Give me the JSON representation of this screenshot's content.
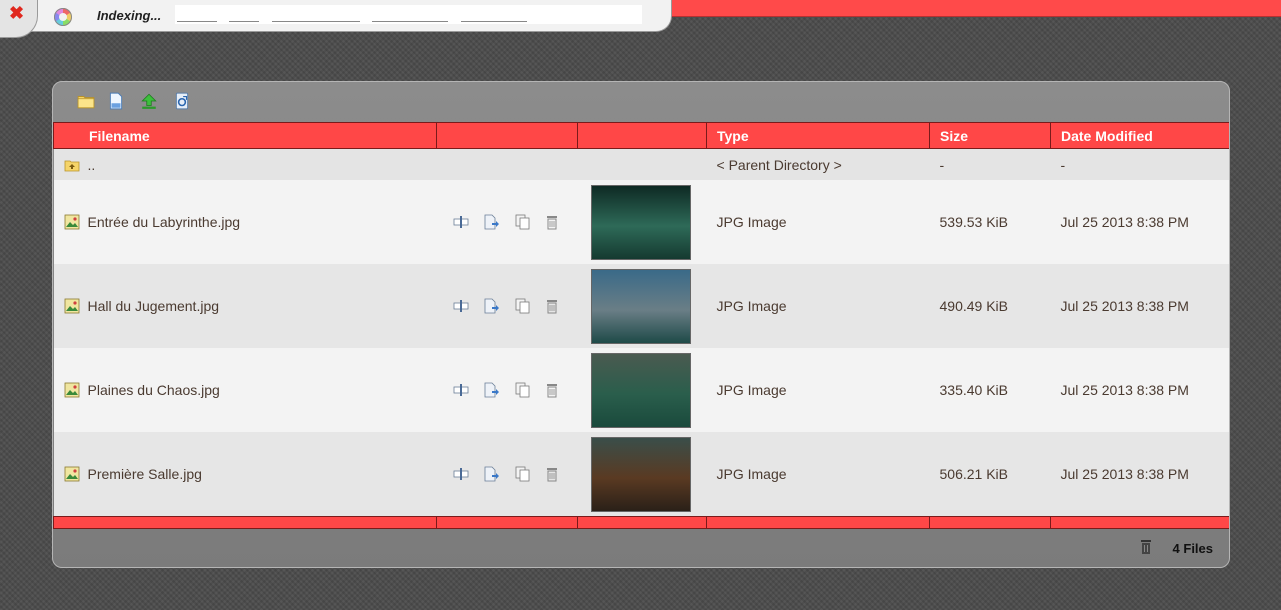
{
  "indexing_label": "Indexing...",
  "toolbar": {
    "buttons": [
      {
        "name": "new-folder-icon"
      },
      {
        "name": "new-file-icon"
      },
      {
        "name": "upload-icon"
      },
      {
        "name": "refresh-icon"
      }
    ]
  },
  "columns": {
    "filename": "Filename",
    "type": "Type",
    "size": "Size",
    "date": "Date Modified"
  },
  "parent": {
    "name": "..",
    "type": "< Parent Directory >",
    "size": "-",
    "date": "-"
  },
  "files": [
    {
      "name": "Entrée du Labyrinthe.jpg",
      "type": "JPG Image",
      "size": "539.53 KiB",
      "date": "Jul 25 2013 8:38 PM",
      "thumb_colors": [
        "#0e2a24",
        "#2e6a58",
        "#153a30"
      ]
    },
    {
      "name": "Hall du Jugement.jpg",
      "type": "JPG Image",
      "size": "490.49 KiB",
      "date": "Jul 25 2013 8:38 PM",
      "thumb_colors": [
        "#3a6a88",
        "#6a7e86",
        "#1e4a48"
      ]
    },
    {
      "name": "Plaines du Chaos.jpg",
      "type": "JPG Image",
      "size": "335.40 KiB",
      "date": "Jul 25 2013 8:38 PM",
      "thumb_colors": [
        "#4a5a50",
        "#2a5e4c",
        "#1a4a3c"
      ]
    },
    {
      "name": "Première Salle.jpg",
      "type": "JPG Image",
      "size": "506.21 KiB",
      "date": "Jul 25 2013 8:38 PM",
      "thumb_colors": [
        "#3a4e4a",
        "#5a3a22",
        "#2a2018"
      ]
    }
  ],
  "status": {
    "file_count": "4 Files"
  },
  "colors": {
    "accent": "#ff4747",
    "panel": "#7b7b7b"
  }
}
